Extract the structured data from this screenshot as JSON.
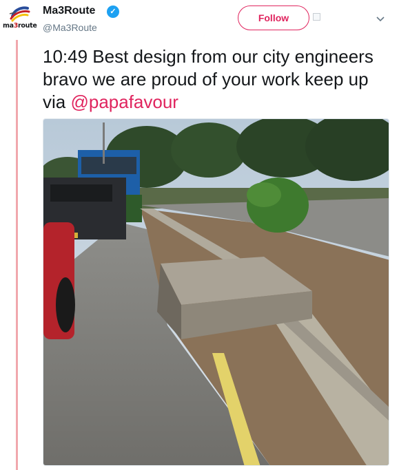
{
  "user": {
    "name": "Ma3Route",
    "handle": "@Ma3Route",
    "verified": true,
    "logo_text_prefix": "ma",
    "logo_text_accent": "3",
    "logo_text_suffix": "route"
  },
  "actions": {
    "follow_label": "Follow"
  },
  "tweet": {
    "text": "10:49 Best design from our city engineers bravo we are proud of your work keep up   via ",
    "mention": "@papafavour"
  },
  "colors": {
    "accent": "#e0245e",
    "verified": "#1da1f2",
    "thread_line": "#f1a7ad"
  },
  "icons": {
    "verified": "verified-badge-icon",
    "menu": "chevron-down-icon",
    "extra": "small-square-icon"
  }
}
